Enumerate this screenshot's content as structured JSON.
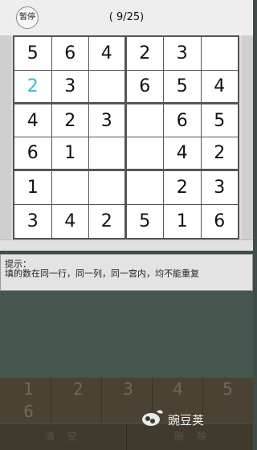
{
  "header": {
    "pause_label": "暂停",
    "progress": "( 9/25)"
  },
  "grid": [
    [
      "5",
      "6",
      "4",
      "2",
      "3",
      ""
    ],
    [
      "2",
      "3",
      "",
      "6",
      "5",
      "4"
    ],
    [
      "4",
      "2",
      "3",
      "",
      "6",
      "5"
    ],
    [
      "6",
      "1",
      "",
      "",
      "4",
      "2"
    ],
    [
      "1",
      "",
      "",
      "",
      "2",
      "3"
    ],
    [
      "3",
      "4",
      "2",
      "5",
      "1",
      "6"
    ]
  ],
  "highlight_color": "#3ab7d8",
  "hint": {
    "title": "提示：",
    "text": "填的数在同一行，同一列，同一宫内，均不能重复"
  },
  "keypad": {
    "keys": [
      "1",
      "2",
      "3",
      "4",
      "5",
      "6"
    ]
  },
  "actions": {
    "clear_label": "清 空",
    "delete_label": "删 除"
  },
  "watermark": {
    "text": "豌豆荚"
  }
}
